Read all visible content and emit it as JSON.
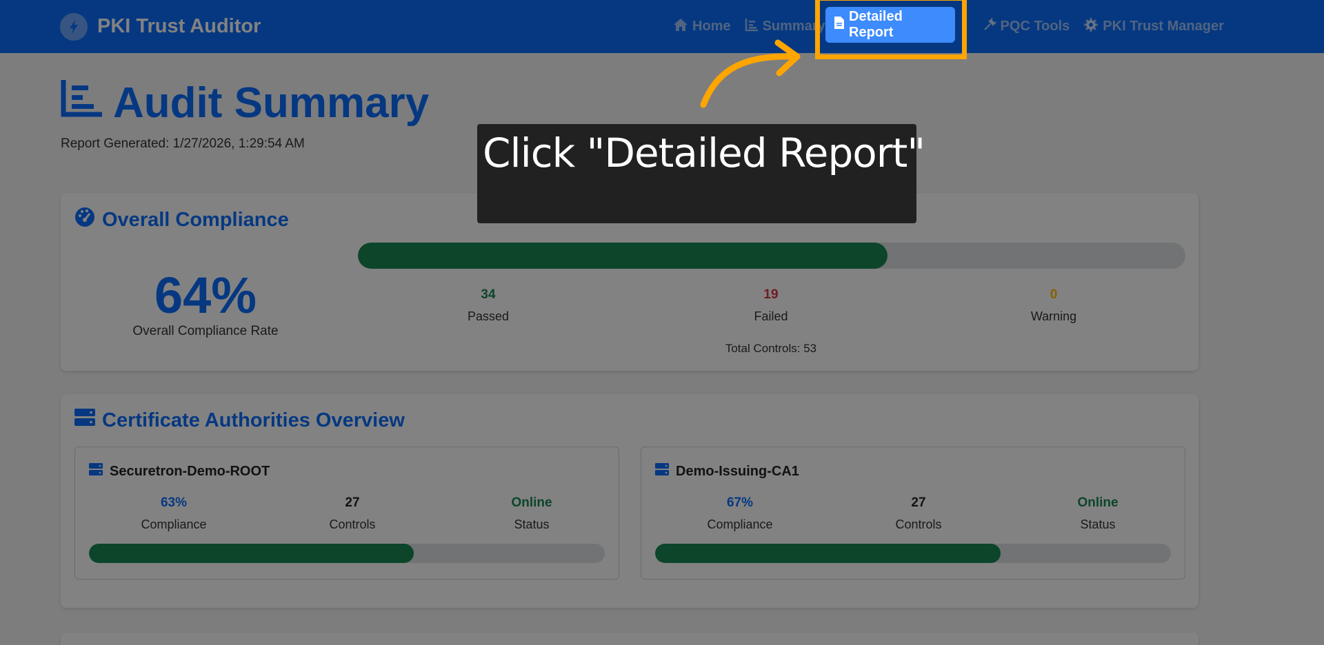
{
  "app": {
    "title": "PKI Trust Auditor"
  },
  "nav": {
    "items": [
      {
        "label": "Home",
        "icon": "home-icon"
      },
      {
        "label": "Summary",
        "icon": "chart-icon"
      },
      {
        "label": "Detailed Report",
        "icon": "document-icon",
        "active": true
      },
      {
        "label": "PQC Tools",
        "icon": "tools-icon"
      },
      {
        "label": "PKI Trust Manager",
        "icon": "gear-icon"
      }
    ]
  },
  "page": {
    "title": "Audit Summary",
    "report_generated": "Report Generated: 1/27/2026, 1:29:54 AM"
  },
  "compliance": {
    "header": "Overall Compliance",
    "rate": "64%",
    "rate_fraction": 0.64,
    "rate_label": "Overall Compliance Rate",
    "passed": "34",
    "passed_label": "Passed",
    "failed": "19",
    "failed_label": "Failed",
    "warning": "0",
    "warning_label": "Warning",
    "total_controls": "Total Controls: 53"
  },
  "ca_overview": {
    "header": "Certificate Authorities Overview",
    "authorities": [
      {
        "name": "Securetron-Demo-ROOT",
        "compliance": "63%",
        "compliance_fraction": 0.63,
        "compliance_label": "Compliance",
        "controls": "27",
        "controls_label": "Controls",
        "status": "Online",
        "status_label": "Status"
      },
      {
        "name": "Demo-Issuing-CA1",
        "compliance": "67%",
        "compliance_fraction": 0.67,
        "compliance_label": "Compliance",
        "controls": "27",
        "controls_label": "Controls",
        "status": "Online",
        "status_label": "Status"
      }
    ]
  },
  "tutorial": {
    "instruction": "Click \"Detailed Report\""
  },
  "colors": {
    "primary": "#0d6efd",
    "success": "#198754",
    "danger": "#dc3545",
    "warning": "#ffc107",
    "highlight": "#ffa500"
  }
}
